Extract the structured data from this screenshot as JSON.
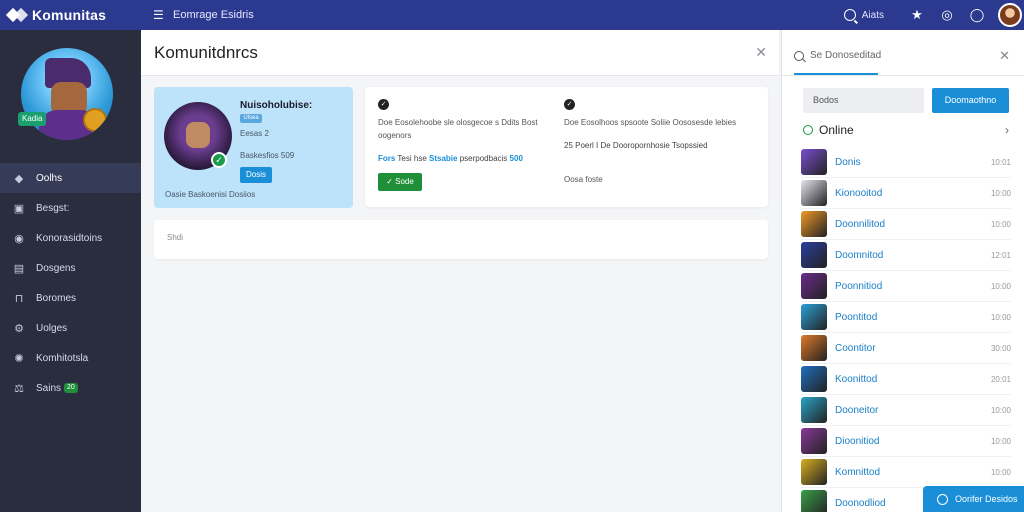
{
  "app": {
    "name": "Komunitas",
    "page_title": "Komunitdnrcs",
    "top_title": "Eomrage Esidris"
  },
  "topbar": {
    "search_label": "Aiats"
  },
  "sidebar": {
    "badge": "Kadia",
    "items": [
      {
        "label": "Oolhs",
        "icon": "chat-icon",
        "active": true
      },
      {
        "label": "Besgst:",
        "icon": "clipboard-icon"
      },
      {
        "label": "Konorasidtoins",
        "icon": "settings-icon"
      },
      {
        "label": "Dosgens",
        "icon": "document-icon"
      },
      {
        "label": "Boromes",
        "icon": "lock-icon"
      },
      {
        "label": "Uolges",
        "icon": "palette-icon"
      },
      {
        "label": "Komhitotsla",
        "icon": "gear-icon"
      },
      {
        "label": "Sains",
        "icon": "scale-icon",
        "count": "20"
      }
    ]
  },
  "profile": {
    "name": "Nuisoholubise:",
    "tag": "Ulsea",
    "level": "Eesas 2",
    "meta": "Baskesfios 509",
    "button": "Dosis",
    "footer": "Oasie Baskoenisi Dosiios"
  },
  "activity": {
    "col1_text": "Doe Eosolehoobe sle olosgecoe s Ddits Bost oogenors",
    "col1_hl_prefix": "Fors",
    "col1_hl_mid": "Tesi hse",
    "col1_hl_bold": "Stsabie",
    "col1_hl_rest": "pserpodbacis",
    "col1_hl_num": "500",
    "col2_text": "Doe Eosolhoos spsoote Soliie Oososesde lebies",
    "col2_hl_num": "25",
    "col2_hl_rest": "Poerl I De Dooropornhosie Tsopssied",
    "button": "Sode",
    "footer": "Oosa foste"
  },
  "comment": {
    "placeholder": "Shdi"
  },
  "rpanel": {
    "search_label": "Se Donoseditad",
    "input_value": "Bodos",
    "action_button": "Doomaothno",
    "online_label": "Online",
    "rows": [
      {
        "name": "Donis",
        "time": "10:01",
        "color": "#7a4fd0"
      },
      {
        "name": "Kionooitod",
        "time": "10:00",
        "color": "#e8e4f1"
      },
      {
        "name": "Doonnilitod",
        "time": "10:00",
        "color": "#f09a2a"
      },
      {
        "name": "Doomnitod",
        "time": "12:01",
        "color": "#2b3fa0"
      },
      {
        "name": "Poonnitiod",
        "time": "10:00",
        "color": "#6a2c8c"
      },
      {
        "name": "Poontitod",
        "time": "10:00",
        "color": "#2ca0d8"
      },
      {
        "name": "Coontitor",
        "time": "30:00",
        "color": "#e07a2a"
      },
      {
        "name": "Koonittod",
        "time": "20:01",
        "color": "#1f6fc0"
      },
      {
        "name": "Dooneitor",
        "time": "10:00",
        "color": "#2aa4c8"
      },
      {
        "name": "Dioonitiod",
        "time": "10:00",
        "color": "#8a3a9a"
      },
      {
        "name": "Komnittod",
        "time": "10:00",
        "color": "#d8b020"
      },
      {
        "name": "Doonodliod",
        "time": "",
        "color": "#3aa04a"
      }
    ]
  },
  "fab": {
    "label": "Oorifer Desidos"
  }
}
